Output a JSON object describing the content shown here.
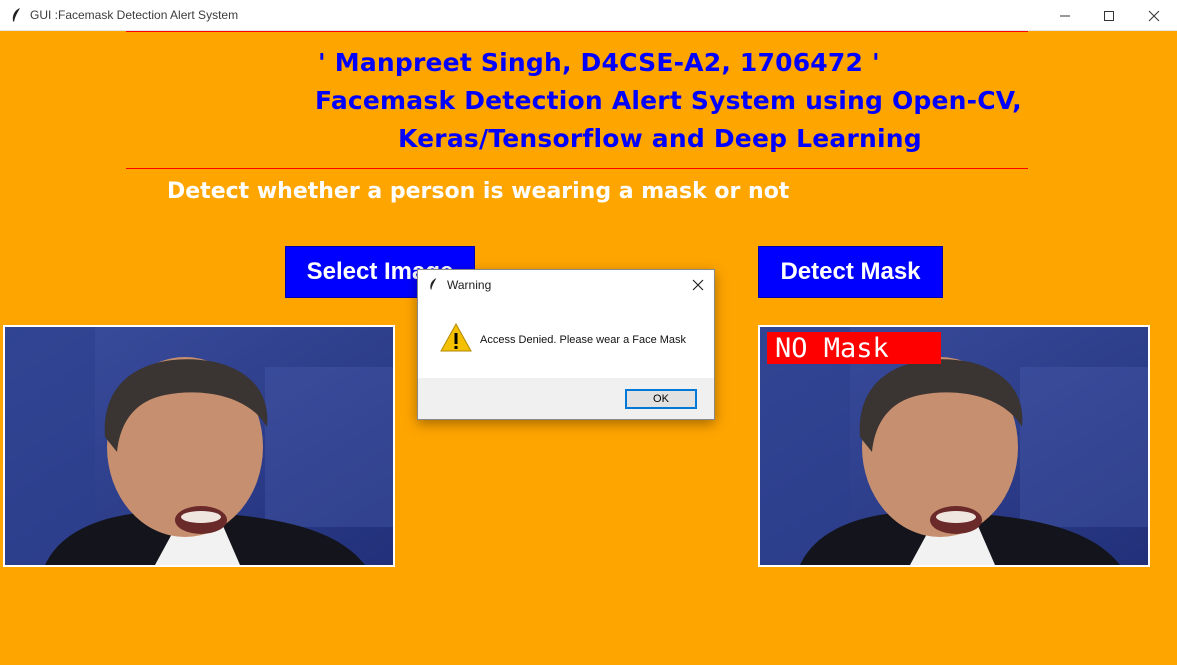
{
  "window": {
    "title": "GUI :Facemask Detection Alert System",
    "controls": {
      "minimize": "minimize-icon",
      "maximize": "maximize-icon",
      "close": "close-icon"
    }
  },
  "header": {
    "line1": "' Manpreet Singh, D4CSE-A2, 1706472 '",
    "line2": "Facemask Detection Alert System using Open-CV,",
    "line3": "Keras/Tensorflow and Deep Learning"
  },
  "subtitle": "Detect whether a person is wearing a mask or not",
  "buttons": {
    "select_image": "Select Image",
    "detect_mask": "Detect Mask"
  },
  "result": {
    "label": "NO Mask"
  },
  "dialog": {
    "title": "Warning",
    "icon": "warning-icon",
    "message": "Access Denied. Please wear a Face Mask",
    "ok_label": "OK"
  },
  "colors": {
    "background": "#ffa500",
    "header_text": "#0000ff",
    "button_bg": "#0000ff",
    "rule": "#ff0000",
    "badge": "#ff0000"
  }
}
